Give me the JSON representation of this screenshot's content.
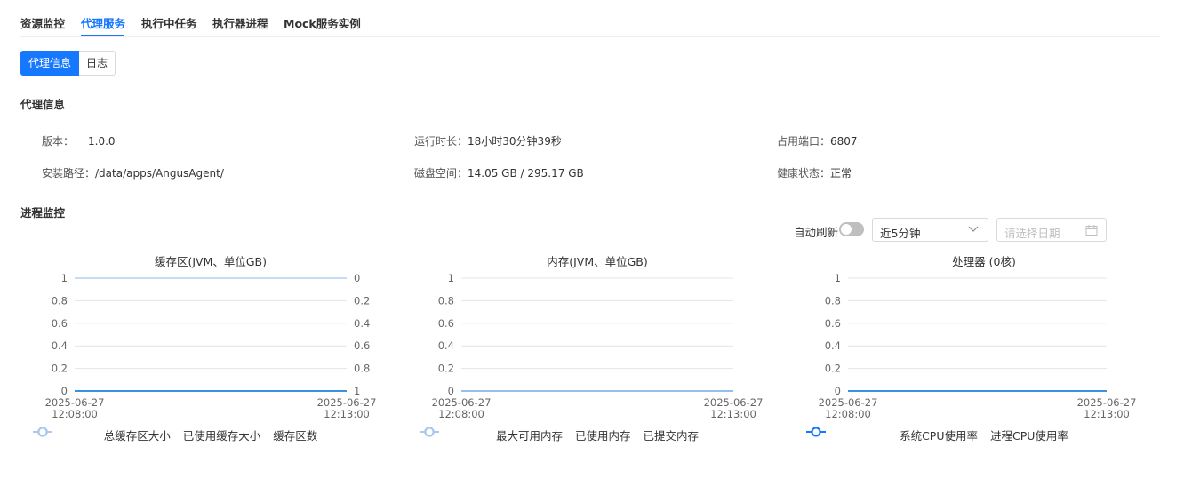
{
  "tabs": [
    {
      "label": "资源监控",
      "active": false
    },
    {
      "label": "代理服务",
      "active": true
    },
    {
      "label": "执行中任务",
      "active": false
    },
    {
      "label": "执行器进程",
      "active": false
    },
    {
      "label": "Mock服务实例",
      "active": false
    }
  ],
  "subtabs": [
    {
      "label": "代理信息",
      "active": true
    },
    {
      "label": "日志",
      "active": false
    }
  ],
  "agent_info": {
    "title": "代理信息",
    "version_label": "版本：",
    "version": "1.0.0",
    "uptime_label": "运行时长：",
    "uptime": "18小时30分钟39秒",
    "port_label": "占用端口：",
    "port": "6807",
    "path_label": "安装路径：",
    "path": "/data/apps/AngusAgent/",
    "disk_label": "磁盘空间：",
    "disk": "14.05 GB / 295.17 GB",
    "health_label": "健康状态：",
    "health": "正常"
  },
  "process_monitor": {
    "title": "进程监控",
    "auto_refresh_label": "自动刷新",
    "auto_refresh_on": false,
    "range_value": "近5分钟",
    "date_placeholder": "请选择日期"
  },
  "colors": {
    "accent": "#1677ff",
    "green": "#52c41a",
    "blue": "#1677ff",
    "light_blue": "#a9c8f2"
  },
  "chart_data": [
    {
      "type": "line",
      "title": "缓存区(JVM、单位GB)",
      "x": [
        "2025-06-27 12:08:00",
        "2025-06-27 12:13:00"
      ],
      "ylim": [
        0,
        1
      ],
      "yticks": [
        "0",
        "0.2",
        "0.4",
        "0.6",
        "0.8",
        "1"
      ],
      "y2ticks": [
        "1",
        "0.8",
        "0.6",
        "0.4",
        "0.2",
        "0"
      ],
      "series": [
        {
          "name": "总缓存区大小",
          "color": "#52c41a",
          "values": [
            0,
            0
          ]
        },
        {
          "name": "已使用缓存大小",
          "color": "#1677ff",
          "values": [
            0,
            0
          ]
        },
        {
          "name": "缓存区数",
          "color": "#a9c8f2",
          "axis": "right",
          "values": [
            0,
            0
          ]
        }
      ]
    },
    {
      "type": "line",
      "title": "内存(JVM、单位GB)",
      "x": [
        "2025-06-27 12:08:00",
        "2025-06-27 12:13:00"
      ],
      "ylim": [
        0,
        1
      ],
      "yticks": [
        "0",
        "0.2",
        "0.4",
        "0.6",
        "0.8",
        "1"
      ],
      "series": [
        {
          "name": "最大可用内存",
          "color": "#52c41a",
          "values": [
            0,
            0
          ]
        },
        {
          "name": "已使用内存",
          "color": "#1677ff",
          "values": [
            0,
            0
          ]
        },
        {
          "name": "已提交内存",
          "color": "#a9c8f2",
          "values": [
            0,
            0
          ]
        }
      ]
    },
    {
      "type": "line",
      "title": "处理器 (0核)",
      "x": [
        "2025-06-27 12:08:00",
        "2025-06-27 12:13:00"
      ],
      "ylim": [
        0,
        1
      ],
      "yticks": [
        "0",
        "0.2",
        "0.4",
        "0.6",
        "0.8",
        "1"
      ],
      "series": [
        {
          "name": "系统CPU使用率",
          "color": "#52c41a",
          "values": [
            0,
            0
          ]
        },
        {
          "name": "进程CPU使用率",
          "color": "#1677ff",
          "values": [
            0,
            0
          ]
        }
      ]
    }
  ]
}
